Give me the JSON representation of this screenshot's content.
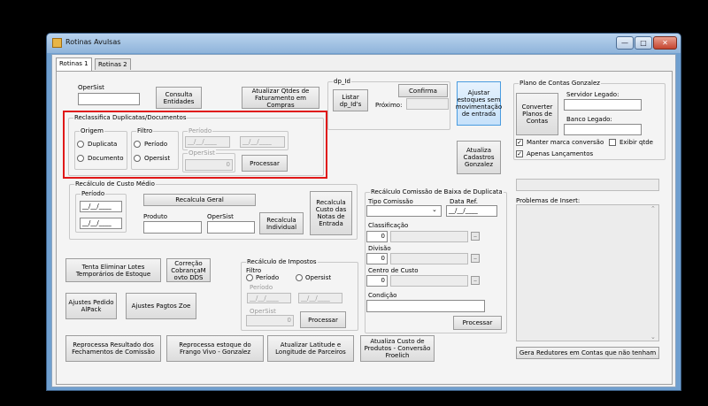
{
  "window": {
    "title": "Rotinas Avulsas",
    "minimize": "—",
    "maximize": "□",
    "close": "✕"
  },
  "tabs": [
    "Rotinas 1",
    "Rotinas 2"
  ],
  "top": {
    "opersist_label": "OperSist",
    "consulta_entidades": "Consulta Entidades",
    "atualizar_qtdes": "Atualizar Qtdes de Faturamento em Compras",
    "dp_id_label": "dp_Id",
    "confirma": "Confirma",
    "listar_dp_ids": "Listar dp_Id's",
    "proximo_label": "Próximo:",
    "ajustar_estoques": "Ajustar estoques sem movimentação de entrada",
    "atualiza_cadastros": "Atualiza Cadastros Gonzalez"
  },
  "reclassifica": {
    "title": "Reclassifica Duplicatas/Documentos",
    "origem_title": "Origem",
    "opt_duplicata": "Duplicata",
    "opt_documento": "Documento",
    "filtro_title": "Filtro",
    "opt_periodo": "Período",
    "opt_opersist": "Opersist",
    "periodo_title": "Período",
    "date_mask": "__/__/____",
    "opersist_title": "OperSist",
    "opersist_value": "0",
    "processar": "Processar"
  },
  "custo_medio": {
    "title": "Recálculo de Custo Médio",
    "periodo_title": "Período",
    "date_mask": "__/__/____",
    "recalcula_geral": "Recalcula Geral",
    "produto_label": "Produto",
    "opersist_label": "OperSist",
    "recalcula_individual": "Recalcula Individual",
    "recalcula_custo_notas": "Recalcula Custo das Notas de Entrada"
  },
  "misc_buttons": {
    "tentar_eliminar": "Tenta Eliminar Lotes Temporários de Estoque",
    "correcao_cobranca": "Correção CobrançaM ovto DDS",
    "ajustes_pedido": "Ajustes Pedido AlPack",
    "ajustes_pagtos": "Ajustes Pagtos Zoe",
    "reprocessa_resultado": "Reprocessa Resultado dos Fechamentos de Comissão",
    "reprocessa_estoque": "Reprocessa estoque do Frango Vivo - Gonzalez",
    "atualizar_latitude": "Atualizar Latitude e Longitude de Parceiros",
    "atualiza_custo": "Atualiza Custo de Produtos - Conversão Froelich"
  },
  "impostos": {
    "title": "Recálculo de Impostos",
    "filtro_title": "Filtro",
    "opt_periodo": "Período",
    "opt_opersist": "Opersist",
    "periodo_title": "Período",
    "date_mask": "__/__/____",
    "opersist_title": "OperSist",
    "opersist_value": "0",
    "processar": "Processar"
  },
  "comissao": {
    "title": "Recálculo Comissão de Baixa de Duplicata",
    "tipo_label": "Tipo Comissão",
    "data_ref_label": "Data Ref.",
    "date_mask": "__/__/____",
    "classificacao_label": "Classificação",
    "classificacao_value": "0",
    "divisao_label": "Divisão",
    "divisao_value": "0",
    "centro_custo_label": "Centro de Custo",
    "centro_custo_value": "0",
    "condicao_label": "Condição",
    "ellipsis": "..",
    "processar": "Processar"
  },
  "plano_contas": {
    "title": "Plano de Contas Gonzalez",
    "converter": "Converter Planos de Contas",
    "servidor_label": "Servidor Legado:",
    "banco_label": "Banco Legado:",
    "manter_marca": "Manter marca conversão",
    "exibir_qtde": "Exibir qtde",
    "apenas_lancamentos": "Apenas Lançamentos",
    "problemas_label": "Problemas de Insert:",
    "gera_redutores": "Gera Redutores em Contas que não tenham"
  }
}
